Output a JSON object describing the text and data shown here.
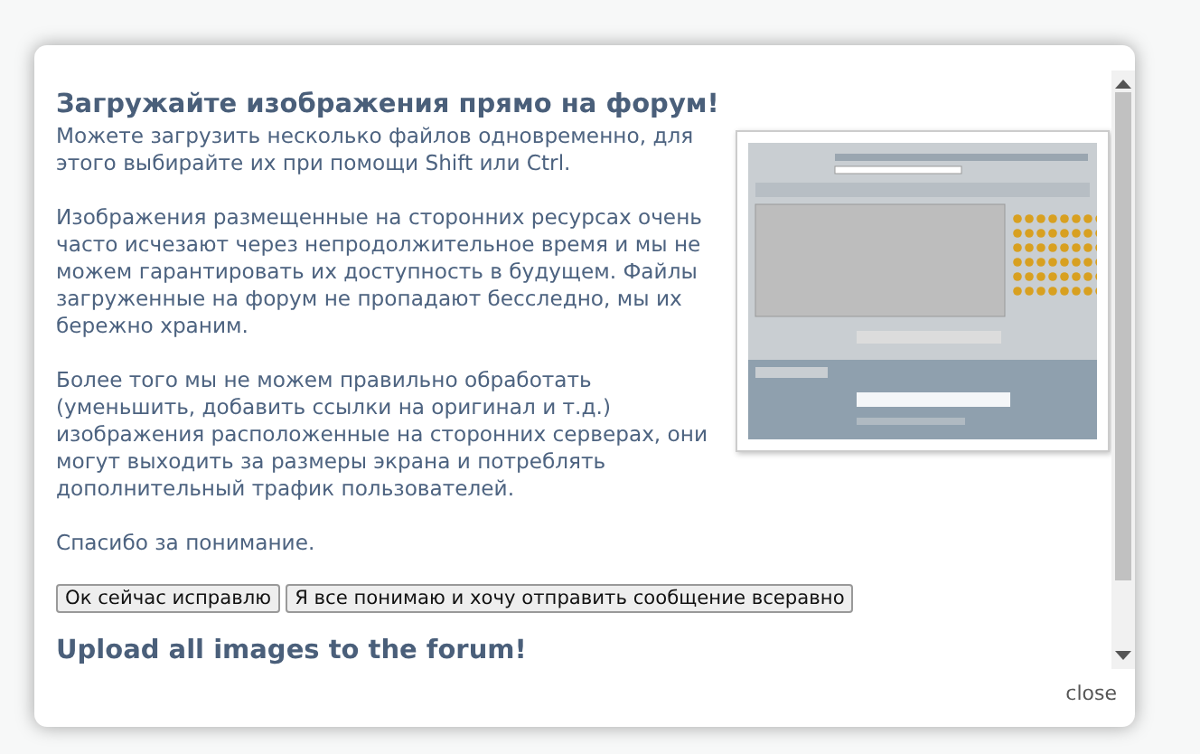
{
  "dialog": {
    "heading": "Загружайте изображения прямо на форум!",
    "paragraphs": [
      "Можете загрузить несколько файлов одновременно, для этого выбирайте их при помощи Shift или Ctrl.",
      "Изображения размещенные на сторонних ресурсах очень часто исчезают через непродолжительное время и мы не можем гарантировать их доступность в будущем. Файлы загруженные на форум не пропадают бесследно, мы их бережно храним.",
      "Более того мы не можем правильно обработать (уменьшить, добавить ссылки на оригинал и т.д.) изображения расположенные на сторонних серверах, они могут выходить за размеры экрана и потреблять дополнительный трафик пользователей.",
      "Спасибо за понимание."
    ],
    "buttons": [
      "Ок сейчас исправлю",
      "Я все понимаю и хочу отправить сообщение всеравно"
    ],
    "second_heading": "Upload all images to the forum!",
    "close": "close"
  }
}
